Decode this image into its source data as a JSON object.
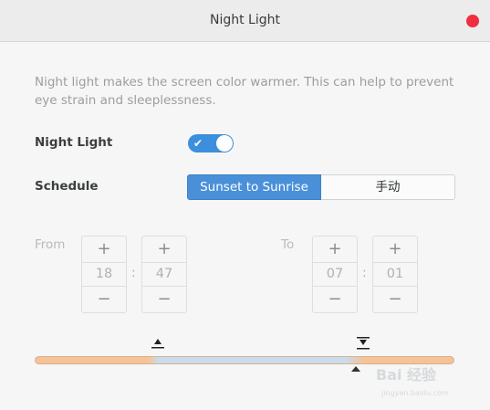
{
  "window": {
    "title": "Night Light"
  },
  "description": "Night light makes the screen color warmer. This can help to prevent eye strain and sleeplessness.",
  "night_light": {
    "label": "Night Light",
    "enabled": true,
    "toggle_check": "✔"
  },
  "schedule": {
    "label": "Schedule",
    "options": [
      "Sunset to Sunrise",
      "手动"
    ],
    "selected": "Sunset to Sunrise"
  },
  "from": {
    "label": "From",
    "hour": "18",
    "minute": "47",
    "separator": ":",
    "plus": "+",
    "minus": "−"
  },
  "to": {
    "label": "To",
    "hour": "07",
    "minute": "01",
    "separator": ":",
    "plus": "+",
    "minus": "−"
  },
  "timeline": {
    "sunset_icon": "sunset-icon",
    "sunrise_icon": "sunrise-icon",
    "warm_color": "#f6c296",
    "cool_color": "#c8dcee"
  },
  "watermark": {
    "text": "Bai 经验",
    "sub": "jingyan.baidu.com"
  },
  "colors": {
    "accent": "#4a90d9",
    "close": "#ef2f3f"
  }
}
